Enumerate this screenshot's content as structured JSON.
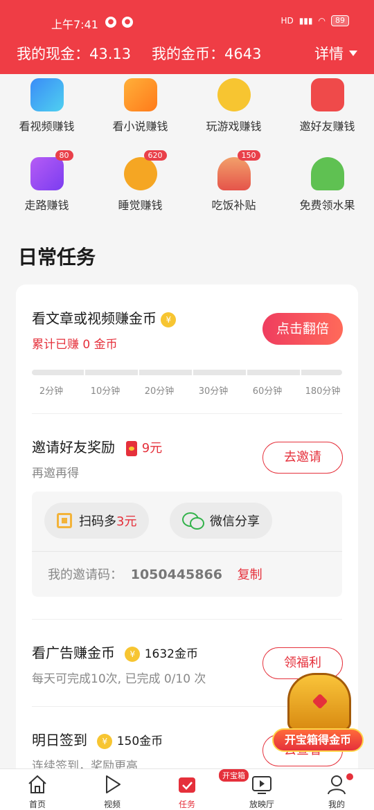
{
  "status": {
    "time": "上午7:41",
    "battery": "89",
    "net": "HD"
  },
  "header": {
    "cash_label": "我的现金：43.13",
    "coins_label": "我的金币：4643",
    "detail_label": "详情"
  },
  "grid": {
    "items": [
      {
        "label": "看视频赚钱",
        "icon": "video-icon"
      },
      {
        "label": "看小说赚钱",
        "icon": "book-icon"
      },
      {
        "label": "玩游戏赚钱",
        "icon": "game-icon"
      },
      {
        "label": "邀好友赚钱",
        "icon": "redpacket-icon"
      },
      {
        "label": "走路赚钱",
        "icon": "walk-icon",
        "badge": "80"
      },
      {
        "label": "睡觉赚钱",
        "icon": "moon-icon",
        "badge": "620"
      },
      {
        "label": "吃饭补贴",
        "icon": "meal-icon",
        "badge": "150"
      },
      {
        "label": "免费领水果",
        "icon": "tree-icon"
      }
    ]
  },
  "daily": {
    "title": "日常任务",
    "task1": {
      "title": "看文章或视频赚金币",
      "earned": "累计已赚 0 金币",
      "button": "点击翻倍",
      "ticks": [
        "2分钟",
        "10分钟",
        "20分钟",
        "30分钟",
        "60分钟",
        "180分钟"
      ],
      "progress": 0
    },
    "task2": {
      "title": "邀请好友奖励",
      "reward": "9元",
      "sub": "再邀再得",
      "button": "去邀请",
      "scan_prefix": "扫码多",
      "scan_amount": "3元",
      "wechat": "微信分享",
      "code_label": "我的邀请码：",
      "code": "1050445866",
      "copy": "复制"
    },
    "task3": {
      "title": "看广告赚金币",
      "reward": "1632金币",
      "sub": "每天可完成10次, 已完成 0/10 次",
      "button": "领福利"
    },
    "task4": {
      "title": "明日签到",
      "reward": "150金币",
      "sub": "连续签到，奖励更高",
      "button": "去查看"
    }
  },
  "treasure": {
    "label": "开宝箱得金币"
  },
  "nav": {
    "items": [
      {
        "label": "首页"
      },
      {
        "label": "视频"
      },
      {
        "label": "任务",
        "badge": "开宝箱"
      },
      {
        "label": "放映厅"
      },
      {
        "label": "我的"
      }
    ]
  },
  "colors": {
    "brand": "#ef3d45",
    "accent": "#e5303b",
    "coin": "#f7c531"
  }
}
